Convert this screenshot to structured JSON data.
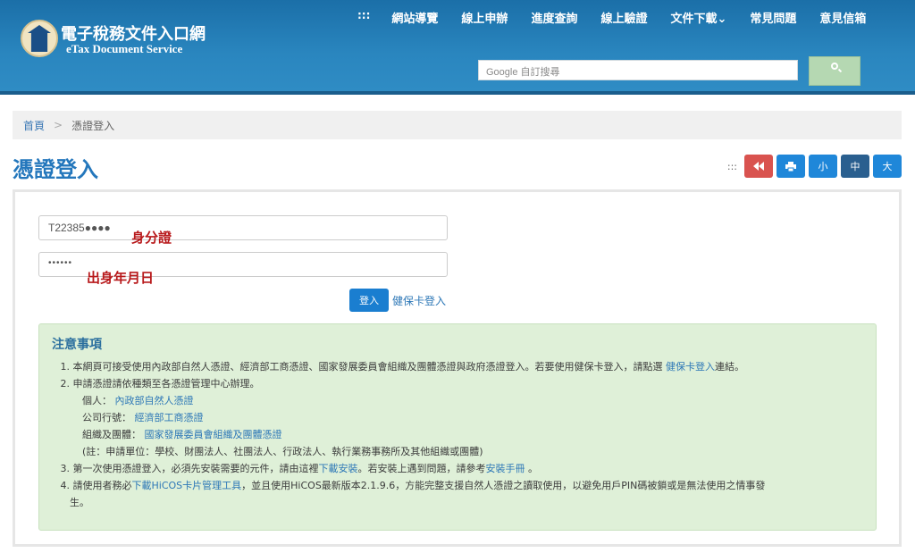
{
  "header": {
    "brand_zh": "電子稅務文件入口網",
    "brand_en": "eTax Document Service",
    "nav_grip": ":::",
    "nav": [
      "網站導覽",
      "線上申辦",
      "進度查詢",
      "線上驗證",
      "文件下載⌄",
      "常見問題",
      "意見信箱"
    ],
    "search_placeholder": "Google 自訂搜尋"
  },
  "breadcrumb": {
    "home": "首頁",
    "separator": ">",
    "current": "憑證登入"
  },
  "page_title": "憑證登入",
  "tools": {
    "grip": ":::",
    "size_small": "小",
    "size_medium": "中",
    "size_large": "大"
  },
  "form": {
    "id_value": "T22385●●●●",
    "id_annotation": "身分證",
    "pw_value": "••••••",
    "pw_annotation": "出身年月日",
    "login_label": "登入",
    "card_login_label": "健保卡登入"
  },
  "notice": {
    "title": "注意事項",
    "item1_num": "1.",
    "item1_text": "本網頁可接受使用內政部自然人憑證、經濟部工商憑證、國家發展委員會組織及團體憑證與政府憑證登入。若要使用健保卡登入，請點選",
    "item1_link": "健保卡登入",
    "item1_tail": "連結。",
    "item2_num": "2.",
    "item2_text": "申請憑證請依種類至各憑證管理中心辦理。",
    "personal_label": "個人：",
    "personal_link": "內政部自然人憑證",
    "company_label": "公司行號：",
    "company_link": "經濟部工商憑證",
    "org_label": "組織及團體：",
    "org_link": "國家發展委員會組織及團體憑證",
    "note": "(註：申請單位：學校、財團法人、社團法人、行政法人、執行業務事務所及其他組織或團體)",
    "item3_num": "3.",
    "item3_text": "第一次使用憑證登入，必須先安裝需要的元件，請由這裡",
    "item3_link1": "下載安裝",
    "item3_mid": "。若安裝上遇到問題，請參考",
    "item3_link2": "安裝手冊",
    "item3_tail": "。",
    "item4_num": "4.",
    "item4_text": "請使用者務必",
    "item4_link": "下載HiCOS卡片管理工具",
    "item4_tail": "，並且使用HiCOS最新版本2.1.9.6，方能完整支援自然人憑證之讀取使用，以避免用戶PIN碼被鎖或是無法使用之情事發",
    "item4_wrap": "生。"
  },
  "colors": {
    "header": "#2a86bf",
    "title": "#2477bc",
    "notice_bg": "#dff0d8",
    "annotation": "#b8191b"
  }
}
